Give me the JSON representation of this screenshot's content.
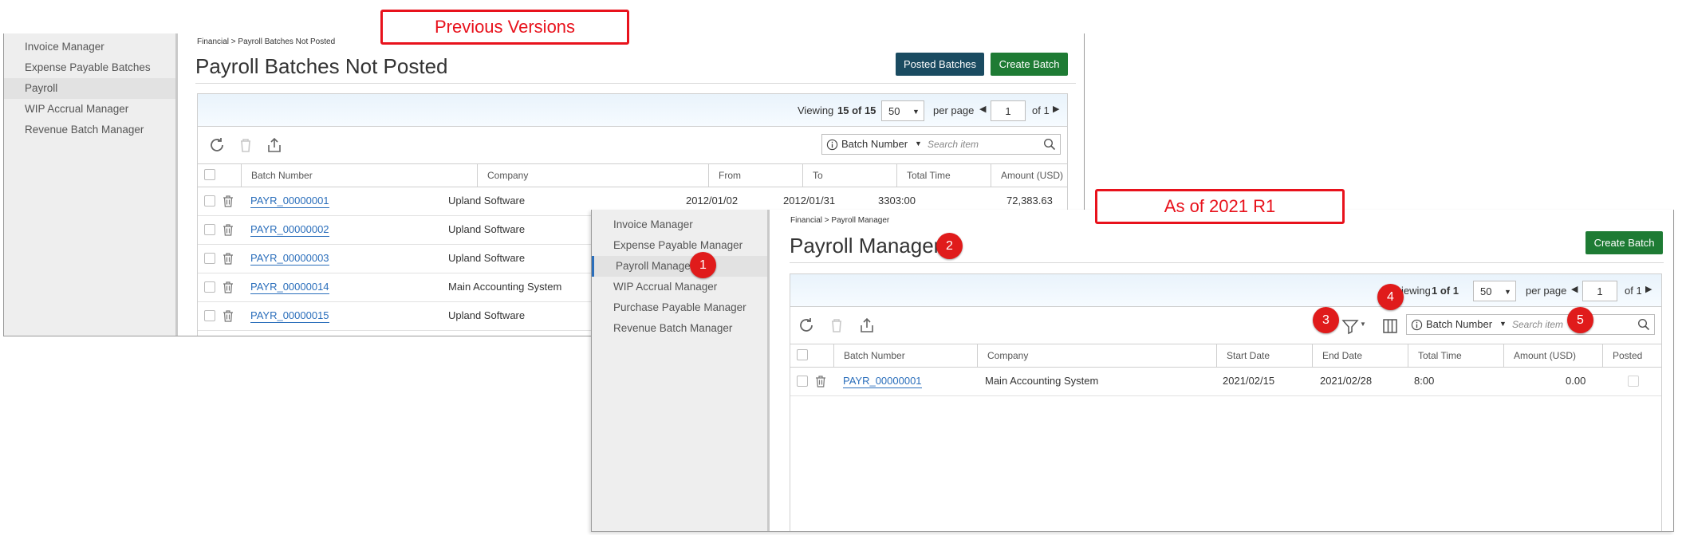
{
  "callouts": {
    "previous": "Previous Versions",
    "current": "As of 2021 R1"
  },
  "badges": [
    "1",
    "2",
    "3",
    "4",
    "5"
  ],
  "old": {
    "sidebar": [
      "Invoice Manager",
      "Expense Payable Batches",
      "Payroll",
      "WIP Accrual Manager",
      "Revenue Batch Manager"
    ],
    "breadcrumb": "Financial > Payroll Batches Not Posted",
    "title": "Payroll Batches Not Posted",
    "buttons": {
      "posted": "Posted Batches",
      "create": "Create Batch"
    },
    "pager": {
      "viewing": "Viewing",
      "count": "15 of 15",
      "per_page_value": "50",
      "per_page": "per page",
      "page": "1",
      "of": "of 1"
    },
    "search": {
      "criteria": "Batch Number",
      "placeholder": "Search item"
    },
    "columns": [
      "Batch Number",
      "Company",
      "From",
      "To",
      "Total Time",
      "Amount (USD)"
    ],
    "rows": [
      {
        "batch": "PAYR_00000001",
        "company": "Upland Software",
        "from": "2012/01/02",
        "to": "2012/01/31",
        "time": "3303:00",
        "amount": "72,383.63"
      },
      {
        "batch": "PAYR_00000002",
        "company": "Upland Software"
      },
      {
        "batch": "PAYR_00000003",
        "company": "Upland Software"
      },
      {
        "batch": "PAYR_00000014",
        "company": "Main Accounting System"
      },
      {
        "batch": "PAYR_00000015",
        "company": "Upland Software"
      }
    ]
  },
  "new": {
    "sidebar": [
      "Invoice Manager",
      "Expense Payable Manager",
      "Payroll Manager",
      "WIP Accrual Manager",
      "Purchase Payable Manager",
      "Revenue Batch Manager"
    ],
    "breadcrumb": "Financial > Payroll Manager",
    "title": "Payroll Manager",
    "buttons": {
      "create": "Create Batch"
    },
    "pager": {
      "viewing": "iewing",
      "count": "1 of 1",
      "per_page_value": "50",
      "per_page": "per page",
      "page": "1",
      "of": "of 1"
    },
    "search": {
      "criteria": "Batch Number",
      "placeholder": "Search item"
    },
    "columns": [
      "Batch Number",
      "Company",
      "Start Date",
      "End Date",
      "Total Time",
      "Amount (USD)",
      "Posted"
    ],
    "rows": [
      {
        "batch": "PAYR_00000001",
        "company": "Main Accounting System",
        "start": "2021/02/15",
        "end": "2021/02/28",
        "time": "8:00",
        "amount": "0.00"
      }
    ]
  },
  "colors": {
    "callout": "#e8121c",
    "badge": "#e01b1b",
    "green": "#1e7b34",
    "navy": "#1a4b61",
    "link": "#2a6ebb"
  }
}
